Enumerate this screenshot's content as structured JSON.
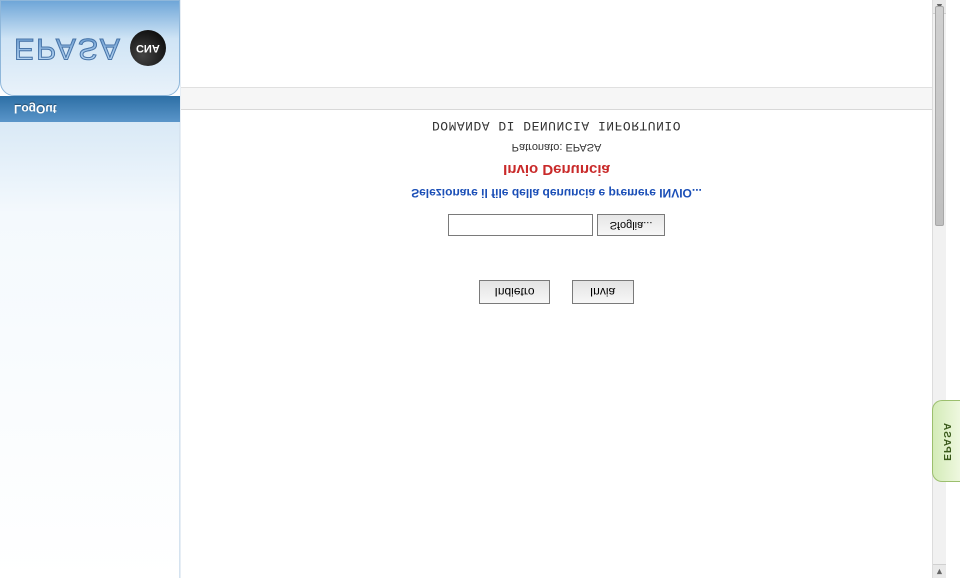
{
  "brand": {
    "name": "EPASA",
    "partner": "CNA"
  },
  "sidebar": {
    "logout": "LogOut"
  },
  "side_tab": {
    "label": "EPASA"
  },
  "form": {
    "title": "DOMANDA DI DENUNCIA INFORTUNIO",
    "patronato_label": "Patronato",
    "patronato_value": "EPASA",
    "section_title": "Invio Denuncia",
    "help_text": "Selezionare il file della denuncia e premere INVIO...",
    "file_value": "",
    "browse_label": "Sfoglia...",
    "back_label": "Indietro",
    "send_label": "Invia"
  }
}
